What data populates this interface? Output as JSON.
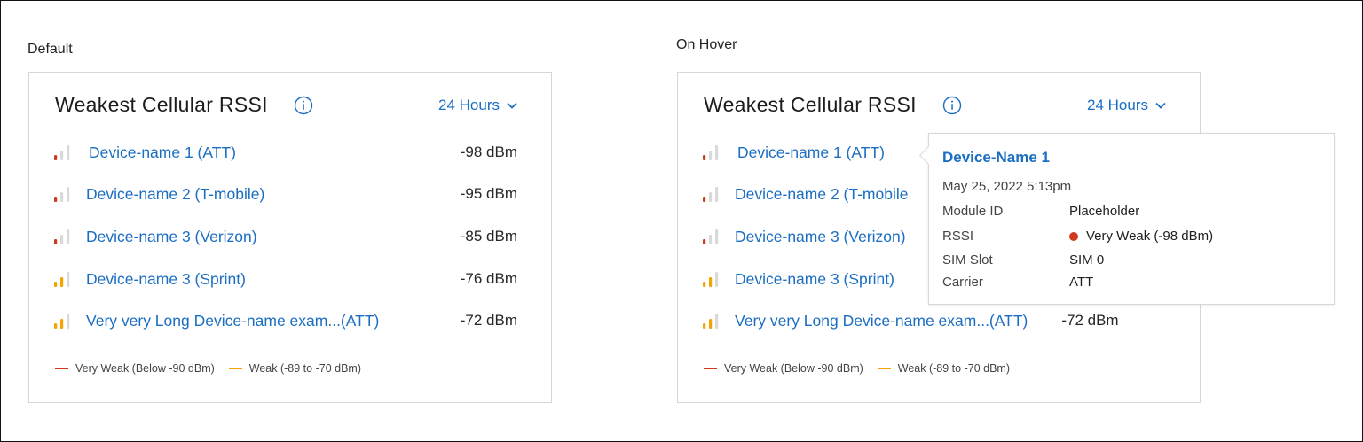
{
  "states": {
    "default_label": "Default",
    "hover_label": "On Hover"
  },
  "widget": {
    "title": "Weakest Cellular RSSI",
    "time_range": "24 Hours",
    "devices": [
      {
        "name": "Device-name 1 (ATT)",
        "value": "-98 dBm",
        "strength": "very-weak",
        "bars": 1
      },
      {
        "name": "Device-name 2 (T-mobile)",
        "value": "-95 dBm",
        "strength": "very-weak",
        "bars": 1
      },
      {
        "name": "Device-name 3 (Verizon)",
        "value": "-85 dBm",
        "strength": "very-weak",
        "bars": 1
      },
      {
        "name": "Device-name 3 (Sprint)",
        "value": "-76 dBm",
        "strength": "weak",
        "bars": 2
      },
      {
        "name": "Very very Long Device-name exam...(ATT)",
        "value": "-72 dBm",
        "strength": "weak",
        "bars": 2
      }
    ],
    "legend": [
      {
        "label": "Very Weak (Below -90 dBm)",
        "color": "#d0391e"
      },
      {
        "label": "Weak (-89 to -70 dBm)",
        "color": "#f5a300"
      }
    ]
  },
  "hover_devices": [
    {
      "name": "Device-name 1 (ATT)",
      "value": ""
    },
    {
      "name": "Device-name 2 (T-mobile",
      "value": ""
    },
    {
      "name": "Device-name 3 (Verizon)",
      "value": ""
    },
    {
      "name": "Device-name 3 (Sprint)",
      "value": ""
    },
    {
      "name": "Very very Long Device-name exam...(ATT)",
      "value": "-72 dBm"
    }
  ],
  "tooltip": {
    "title": "Device-Name 1",
    "date": "May 25, 2022 5:13pm",
    "rows": [
      {
        "key": "Module ID",
        "value": "Placeholder"
      },
      {
        "key": "RSSI",
        "value": "Very Weak (-98 dBm)"
      },
      {
        "key": "SIM Slot",
        "value": "SIM 0"
      },
      {
        "key": "Carrier",
        "value": "ATT"
      }
    ]
  },
  "colors": {
    "very_weak": "#d0391e",
    "weak": "#f5a300",
    "inactive_bar": "#d9d9d9",
    "link": "#1b6ec2"
  }
}
